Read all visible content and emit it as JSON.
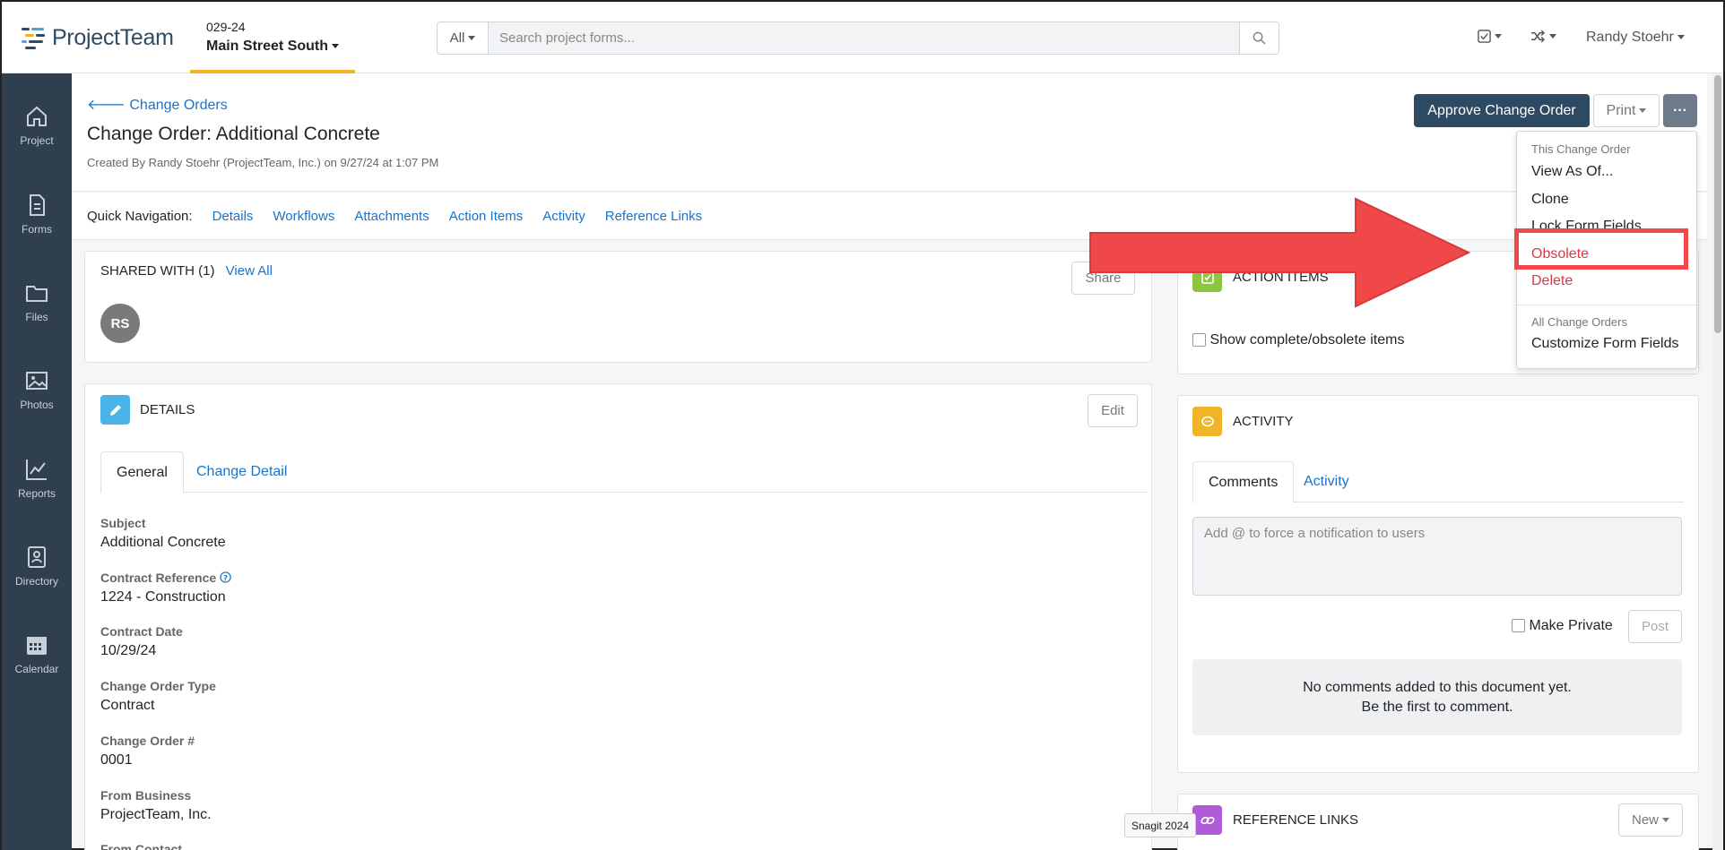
{
  "topbar": {
    "logo_text": "ProjectTeam",
    "project_number": "029-24",
    "project_name": "Main Street South",
    "search_scope": "All",
    "search_placeholder": "Search project forms...",
    "user_name": "Randy Stoehr"
  },
  "sidebar": {
    "items": [
      {
        "label": "Project",
        "icon": "home-icon"
      },
      {
        "label": "Forms",
        "icon": "document-icon"
      },
      {
        "label": "Files",
        "icon": "folder-icon"
      },
      {
        "label": "Photos",
        "icon": "image-icon"
      },
      {
        "label": "Reports",
        "icon": "chart-icon"
      },
      {
        "label": "Directory",
        "icon": "contact-icon"
      },
      {
        "label": "Calendar",
        "icon": "calendar-icon"
      }
    ]
  },
  "header": {
    "back_link": "Change Orders",
    "title": "Change Order: Additional Concrete",
    "created_by": "Created By Randy Stoehr (ProjectTeam, Inc.) on 9/27/24 at 1:07 PM",
    "approve_button": "Approve Change Order",
    "print_button": "Print",
    "more_button": "···"
  },
  "quicknav": {
    "label": "Quick Navigation:",
    "links": [
      "Details",
      "Workflows",
      "Attachments",
      "Action Items",
      "Activity",
      "Reference Links"
    ]
  },
  "shared": {
    "title": "SHARED WITH (1)",
    "view_all": "View All",
    "share_button": "Share",
    "avatar_initials": "RS"
  },
  "details": {
    "title": "DETAILS",
    "edit_button": "Edit",
    "tabs": [
      "General",
      "Change Detail"
    ],
    "fields": [
      {
        "label": "Subject",
        "value": "Additional Concrete"
      },
      {
        "label": "Contract Reference",
        "value": "1224 - Construction"
      },
      {
        "label": "Contract Date",
        "value": "10/29/24"
      },
      {
        "label": "Change Order Type",
        "value": "Contract"
      },
      {
        "label": "Change Order #",
        "value": "0001"
      },
      {
        "label": "From Business",
        "value": "ProjectTeam, Inc."
      },
      {
        "label": "From Contact",
        "value": ""
      }
    ]
  },
  "action_items": {
    "title": "ACTION ITEMS",
    "show_complete": "Show complete/obsolete items"
  },
  "activity": {
    "title": "ACTIVITY",
    "tabs": [
      "Comments",
      "Activity"
    ],
    "comment_placeholder": "Add @ to force a notification to users",
    "make_private": "Make Private",
    "post_button": "Post",
    "empty_line1": "No comments added to this document yet.",
    "empty_line2": "Be the first to comment."
  },
  "reference_links": {
    "title": "REFERENCE LINKS",
    "new_button": "New"
  },
  "dropdown": {
    "section1": "This Change Order",
    "items1": [
      "View As Of...",
      "Clone",
      "Lock Form Fields",
      "Obsolete",
      "Delete"
    ],
    "section2": "All Change Orders",
    "items2": [
      "Customize Form Fields"
    ]
  },
  "tooltip": "Snagit 2024",
  "colors": {
    "accent": "#1a73c9",
    "primary": "#2e4a62",
    "danger": "#d73a49",
    "annotation": "#f04848"
  }
}
